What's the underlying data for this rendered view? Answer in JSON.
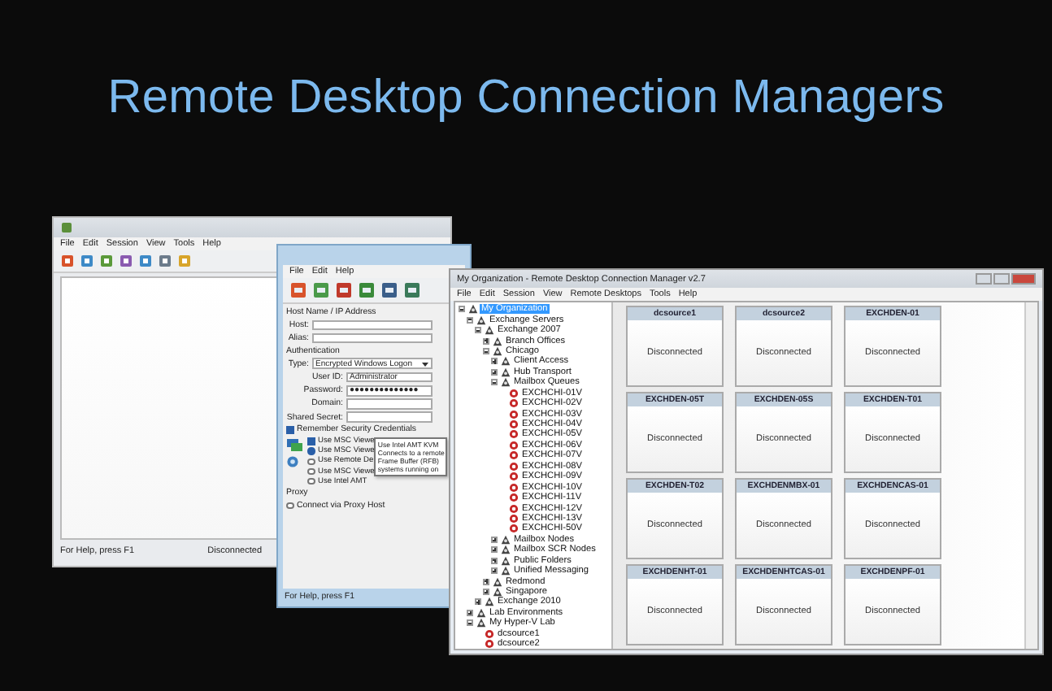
{
  "title": "Remote Desktop Connection Managers",
  "back_window": {
    "menu": [
      "File",
      "Edit",
      "Session",
      "View",
      "Tools",
      "Help"
    ],
    "status_left": "For Help, press F1",
    "status_right": "Disconnected"
  },
  "dialog": {
    "menu": [
      "File",
      "Edit",
      "Help"
    ],
    "host_heading": "Host Name / IP Address",
    "host_fields": [
      "Host:",
      "Alias:"
    ],
    "auth_heading": "Authentication",
    "type_label": "Type:",
    "type_value": "Encrypted Windows Logon",
    "fields": [
      {
        "label": "User ID:",
        "value": "Administrator"
      },
      {
        "label": "Password:",
        "value": "●●●●●●●●●●●●●●"
      },
      {
        "label": "Domain:"
      },
      {
        "label": "Shared Secret:"
      }
    ],
    "remember": {
      "label": "Remember Security Credentials",
      "checked": true
    },
    "options": [
      {
        "kind": "checkbox",
        "label": "Use MSC Viewe",
        "checked": true
      },
      {
        "kind": "radio",
        "label": "Use MSC Viewe",
        "checked": true
      },
      {
        "kind": "radio",
        "label": "Use Remote De",
        "checked": false
      },
      {
        "kind": "radio",
        "label": "Use MSC Viewe",
        "checked": false
      },
      {
        "kind": "radio",
        "label": "Use Intel AMT",
        "checked": false
      }
    ],
    "tooltip": [
      "Use Intel AMT KVM",
      "Connects to a remote",
      "Frame Buffer (RFB)",
      "systems running on"
    ],
    "proxy_heading": "Proxy",
    "proxy": {
      "label": "Connect via Proxy Host",
      "checked": false
    },
    "status": "For Help, press F1"
  },
  "main_window": {
    "title": "My Organization - Remote Desktop Connection Manager v2.7",
    "menu": [
      "File",
      "Edit",
      "Session",
      "View",
      "Remote Desktops",
      "Tools",
      "Help"
    ],
    "tree": [
      {
        "kind": "group",
        "label": "My Organization",
        "selected": true,
        "expanded": true,
        "children": [
          {
            "kind": "group",
            "label": "Exchange Servers",
            "selected": false,
            "expanded": true,
            "children": [
              {
                "kind": "group",
                "label": "Exchange 2007",
                "selected": false,
                "expanded": true,
                "children": [
                  {
                    "kind": "group",
                    "label": "Branch Offices",
                    "selected": false,
                    "expanded": false
                  },
                  {
                    "kind": "group",
                    "label": "Chicago",
                    "selected": false,
                    "expanded": true,
                    "children": [
                      {
                        "kind": "group",
                        "label": "Client Access",
                        "selected": false,
                        "expanded": false
                      },
                      {
                        "kind": "group",
                        "label": "Hub Transport",
                        "selected": false,
                        "expanded": false
                      },
                      {
                        "kind": "group",
                        "label": "Mailbox Queues",
                        "selected": false,
                        "expanded": true,
                        "children": [
                          {
                            "kind": "server",
                            "label": "EXCHCHI-01V",
                            "selected": false
                          },
                          {
                            "kind": "server",
                            "label": "EXCHCHI-02V",
                            "selected": false
                          },
                          {
                            "kind": "server",
                            "label": "EXCHCHI-03V",
                            "selected": false
                          },
                          {
                            "kind": "server",
                            "label": "EXCHCHI-04V",
                            "selected": false
                          },
                          {
                            "kind": "server",
                            "label": "EXCHCHI-05V",
                            "selected": false
                          },
                          {
                            "kind": "server",
                            "label": "EXCHCHI-06V",
                            "selected": false
                          },
                          {
                            "kind": "server",
                            "label": "EXCHCHI-07V",
                            "selected": false
                          },
                          {
                            "kind": "server",
                            "label": "EXCHCHI-08V",
                            "selected": false
                          },
                          {
                            "kind": "server",
                            "label": "EXCHCHI-09V",
                            "selected": false
                          },
                          {
                            "kind": "server",
                            "label": "EXCHCHI-10V",
                            "selected": false
                          },
                          {
                            "kind": "server",
                            "label": "EXCHCHI-11V",
                            "selected": false
                          },
                          {
                            "kind": "server",
                            "label": "EXCHCHI-12V",
                            "selected": false
                          },
                          {
                            "kind": "server",
                            "label": "EXCHCHI-13V",
                            "selected": false
                          },
                          {
                            "kind": "server",
                            "label": "EXCHCHI-50V",
                            "selected": false
                          }
                        ]
                      },
                      {
                        "kind": "group",
                        "label": "Mailbox Nodes",
                        "selected": false,
                        "expanded": false
                      },
                      {
                        "kind": "group",
                        "label": "Mailbox SCR Nodes",
                        "selected": false,
                        "expanded": false
                      },
                      {
                        "kind": "group",
                        "label": "Public Folders",
                        "selected": false,
                        "expanded": false
                      },
                      {
                        "kind": "group",
                        "label": "Unified Messaging",
                        "selected": false,
                        "expanded": false
                      }
                    ]
                  },
                  {
                    "kind": "group",
                    "label": "Redmond",
                    "selected": false,
                    "expanded": false
                  },
                  {
                    "kind": "group",
                    "label": "Singapore",
                    "selected": false,
                    "expanded": false
                  }
                ]
              },
              {
                "kind": "group",
                "label": "Exchange 2010",
                "selected": false,
                "expanded": false
              }
            ]
          },
          {
            "kind": "group",
            "label": "Lab Environments",
            "selected": false,
            "expanded": false
          },
          {
            "kind": "group",
            "label": "My Hyper-V Lab",
            "selected": false,
            "expanded": true,
            "children": [
              {
                "kind": "server",
                "label": "dcsource1",
                "selected": false
              },
              {
                "kind": "server",
                "label": "dcsource2",
                "selected": false
              }
            ]
          }
        ]
      }
    ],
    "tiles": [
      {
        "name": "dcsource1",
        "status": "Disconnected"
      },
      {
        "name": "dcsource2",
        "status": "Disconnected"
      },
      {
        "name": "EXCHDEN-01",
        "status": "Disconnected"
      },
      {
        "name": "EXCHDEN-05T",
        "status": "Disconnected"
      },
      {
        "name": "EXCHDEN-05S",
        "status": "Disconnected"
      },
      {
        "name": "EXCHDEN-T01",
        "status": "Disconnected"
      },
      {
        "name": "EXCHDEN-T02",
        "status": "Disconnected"
      },
      {
        "name": "EXCHDENMBX-01",
        "status": "Disconnected"
      },
      {
        "name": "EXCHDENCAS-01",
        "status": "Disconnected"
      },
      {
        "name": "EXCHDENHT-01",
        "status": "Disconnected"
      },
      {
        "name": "EXCHDENHTCAS-01",
        "status": "Disconnected"
      },
      {
        "name": "EXCHDENPF-01",
        "status": "Disconnected"
      }
    ]
  }
}
